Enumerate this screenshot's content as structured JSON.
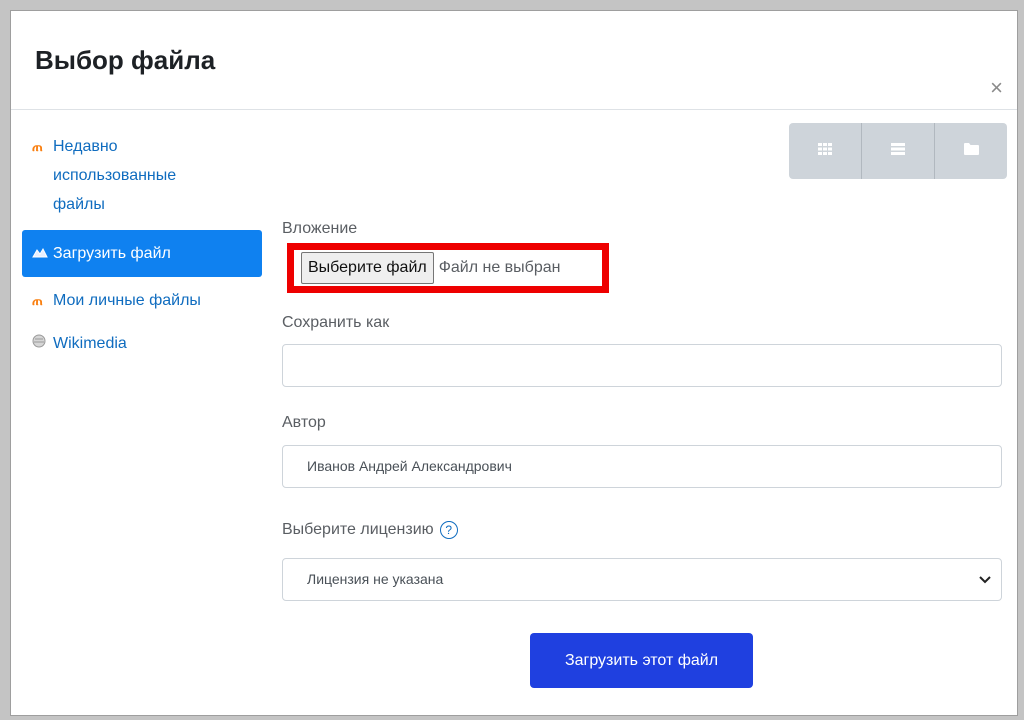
{
  "dialog": {
    "title": "Выбор файла",
    "close_label": "×"
  },
  "sidebar": {
    "items": [
      {
        "label": "Недавно использованные файлы",
        "icon": "moodle-icon"
      },
      {
        "label": "Загрузить файл",
        "icon": "upload-icon",
        "active": true
      },
      {
        "label": "Мои личные файлы",
        "icon": "moodle-icon"
      },
      {
        "label": "Wikimedia",
        "icon": "wikimedia-icon"
      }
    ]
  },
  "view_buttons": [
    {
      "icon": "grid-view-icon"
    },
    {
      "icon": "list-view-icon"
    },
    {
      "icon": "folder-view-icon"
    }
  ],
  "form": {
    "attachment_label": "Вложение",
    "choose_file_button": "Выберите файл",
    "file_status": "Файл не выбран",
    "save_as_label": "Сохранить как",
    "save_as_value": "",
    "author_label": "Автор",
    "author_value": "Иванов Андрей Александрович",
    "license_label": "Выберите лицензию",
    "license_value": "Лицензия не указана",
    "help_icon": "?",
    "submit_label": "Загрузить этот файл"
  },
  "colors": {
    "active_item": "#0f81f0",
    "submit_button": "#1f40e0",
    "highlight_box": "#ee0000",
    "link": "#0f6cbf"
  }
}
